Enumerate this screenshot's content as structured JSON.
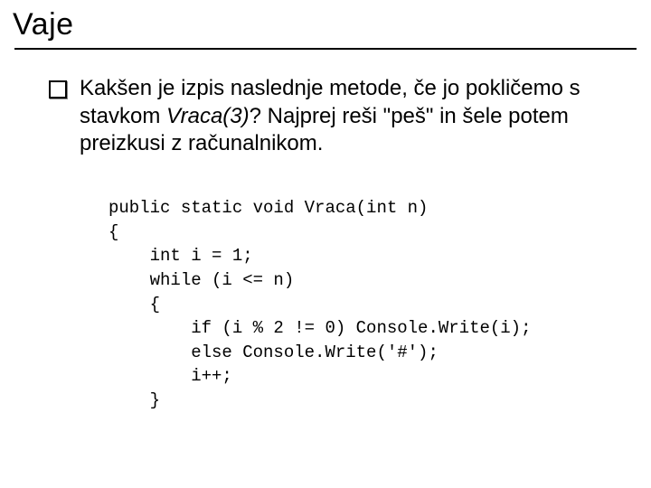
{
  "title": "Vaje",
  "bullet": {
    "part1": "Kakšen je izpis naslednje metode, če  jo pokličemo s stavkom ",
    "italic": "Vraca(3)",
    "part2": "? Najprej reši \"peš\" in šele potem preizkusi z računalnikom."
  },
  "code": {
    "l1": "public static void Vraca(int n)",
    "l2": "{",
    "l3": "    int i = 1;",
    "l4": "    while (i <= n)",
    "l5": "    {",
    "l6": "        if (i % 2 != 0) Console.Write(i);",
    "l7": "        else Console.Write('#');",
    "l8": "        i++;",
    "l9": "    }"
  }
}
